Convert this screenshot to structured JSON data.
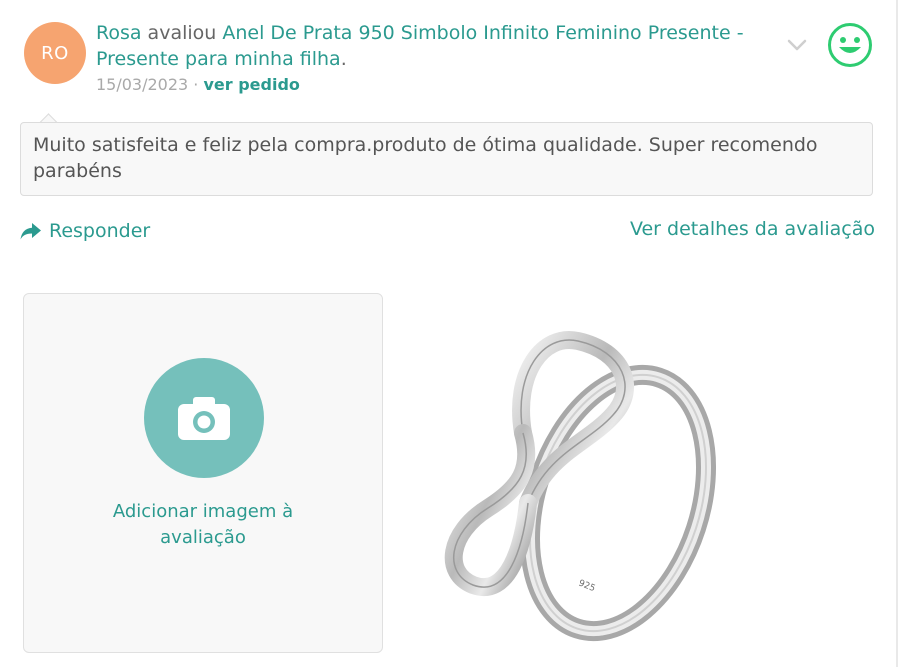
{
  "review": {
    "avatar_initials": "RO",
    "author": "Rosa",
    "action": " avaliou ",
    "product_line1": "Anel De Prata 950 Simbolo Infinito Feminino Presente",
    "product_line2": "- Presente para minha filha",
    "end_punct": ".",
    "date": "15/03/2023",
    "meta_sep": " · ",
    "order_link": "ver pedido",
    "body": "Muito satisfeita e feliz pela compra.produto de ótima qualidade. Super recomendo parabéns",
    "sentiment_icon": "happy-face-icon",
    "expand_icon": "chevron-down-icon"
  },
  "actions": {
    "reply_label": "Responder",
    "details_label": "Ver detalhes da avaliação"
  },
  "upload": {
    "label_line1": "Adicionar imagem à",
    "label_line2": "avaliação",
    "icon": "camera-icon"
  },
  "product_image": {
    "engraving": "925"
  },
  "colors": {
    "accent": "#2b9a8f",
    "avatar_bg": "#f6a470",
    "smiley": "#2ecc71",
    "upload_circle": "#75c0bb"
  }
}
